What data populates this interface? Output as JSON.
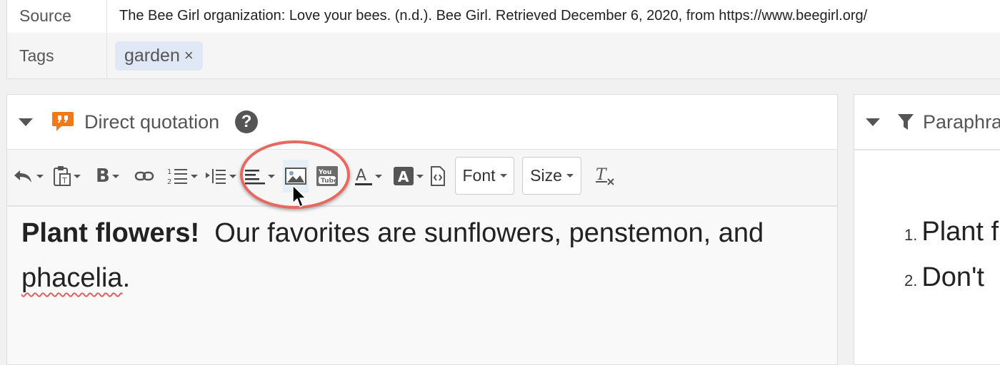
{
  "details": {
    "source_label": "Source",
    "source_value": "The Bee Girl organization: Love your bees. (n.d.). Bee Girl. Retrieved December 6, 2020, from https://www.beegirl.org/",
    "tags_label": "Tags",
    "tags": [
      {
        "label": "garden",
        "remove": "×"
      }
    ]
  },
  "left_panel": {
    "title": "Direct quotation",
    "help": "?",
    "toolbar": {
      "font_label": "Font",
      "size_label": "Size",
      "icons": [
        "undo-icon",
        "paste-icon",
        "bold-icon",
        "link-icon",
        "numbered-list-icon",
        "indent-icon",
        "align-icon",
        "image-icon",
        "youtube-icon",
        "text-color-icon",
        "background-color-icon",
        "source-code-icon",
        "clear-format-icon"
      ]
    },
    "editor": {
      "bold_text": "Plant flowers!",
      "text": "  Our favorites are sunflowers, penstemon, and",
      "misspelled": "phacelia",
      "end": "."
    }
  },
  "right_panel": {
    "title": "Paraphra",
    "items": [
      {
        "num": "1.",
        "text": "Plant f"
      },
      {
        "num": "2.",
        "text": "Don't"
      }
    ]
  },
  "colors": {
    "accent_orange": "#f07a1a",
    "highlight_ring": "#e8685f",
    "tag_bg": "#e1e8f5"
  }
}
